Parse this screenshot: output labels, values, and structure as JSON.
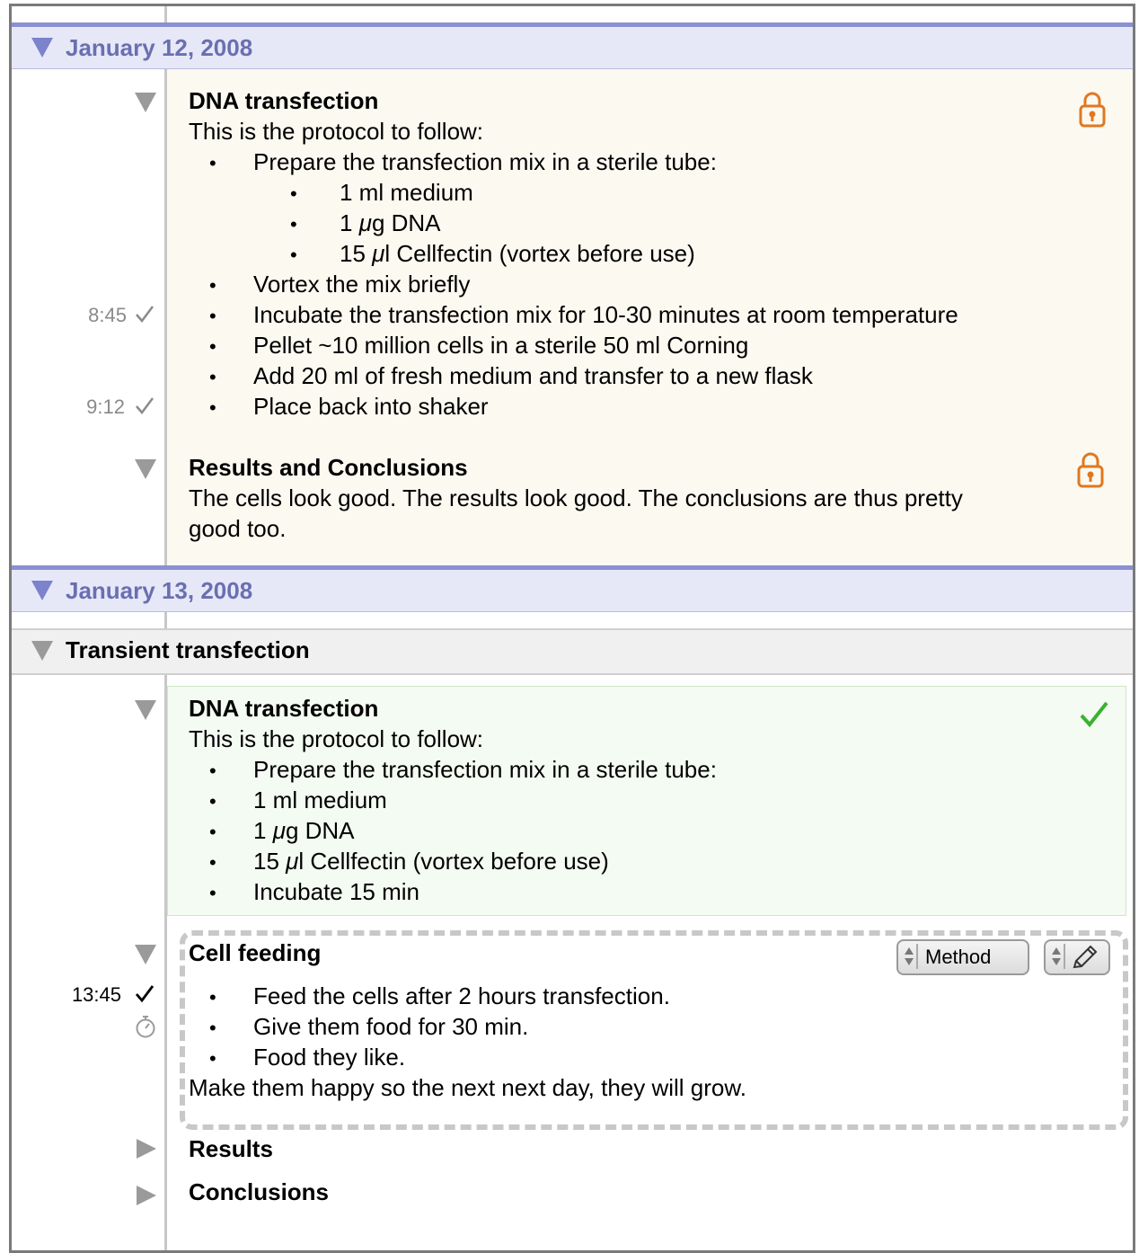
{
  "day1": {
    "date": "January 12, 2008",
    "protocol": {
      "title": "DNA transfection",
      "intro": "This is the protocol to follow:",
      "step1": "Prepare the transfection mix in a sterile tube:",
      "sub1": "1 ml medium",
      "sub2_pre": "1 ",
      "sub2_mu": "μ",
      "sub2_post": "g DNA",
      "sub3_pre": "15 ",
      "sub3_mu": "μ",
      "sub3_post": "l Cellfectin (vortex before use)",
      "step2": "Vortex the mix briefly",
      "step3": "Incubate the transfection mix for 10-30 minutes at room temperature",
      "step4": "Pellet ~10 million cells in a sterile 50 ml Corning",
      "step5": "Add 20 ml of fresh medium and transfer to a new flask",
      "step6": "Place back into shaker",
      "time1": "8:45",
      "time2": "9:12"
    },
    "results": {
      "title": "Results and Conclusions",
      "line1": "The cells look good. The results look good. The conclusions are thus pretty",
      "line2": "good too."
    }
  },
  "day2": {
    "date": "January 13, 2008",
    "section": "Transient transfection",
    "protocol": {
      "title": "DNA transfection",
      "intro": "This is the protocol to follow:",
      "step1": "Prepare the transfection mix in a sterile tube:",
      "step2": "1 ml medium",
      "step3_pre": "1 ",
      "step3_mu": "μ",
      "step3_post": "g DNA",
      "step4_pre": "15 ",
      "step4_mu": "μ",
      "step4_post": "l Cellfectin (vortex before use)",
      "step5": "Incubate 15 min"
    },
    "feeding": {
      "title": "Cell feeding",
      "type_select": "Method",
      "time": "13:45",
      "item1": "Feed the cells after 2 hours transfection.",
      "item2": "Give them food for 30 min.",
      "item3": "Food they like.",
      "note": "Make them happy so the next next day, they will grow."
    },
    "results_title": "Results",
    "conclusions_title": "Conclusions"
  },
  "colors": {
    "date_bar": "#e6e8f8",
    "date_text": "#6a6fb0",
    "locked_bg": "#fcf9f1",
    "done_bg": "#f4fbf2",
    "lock": "#e07820",
    "done_check": "#3cb032"
  },
  "bullet_glyph": "•"
}
